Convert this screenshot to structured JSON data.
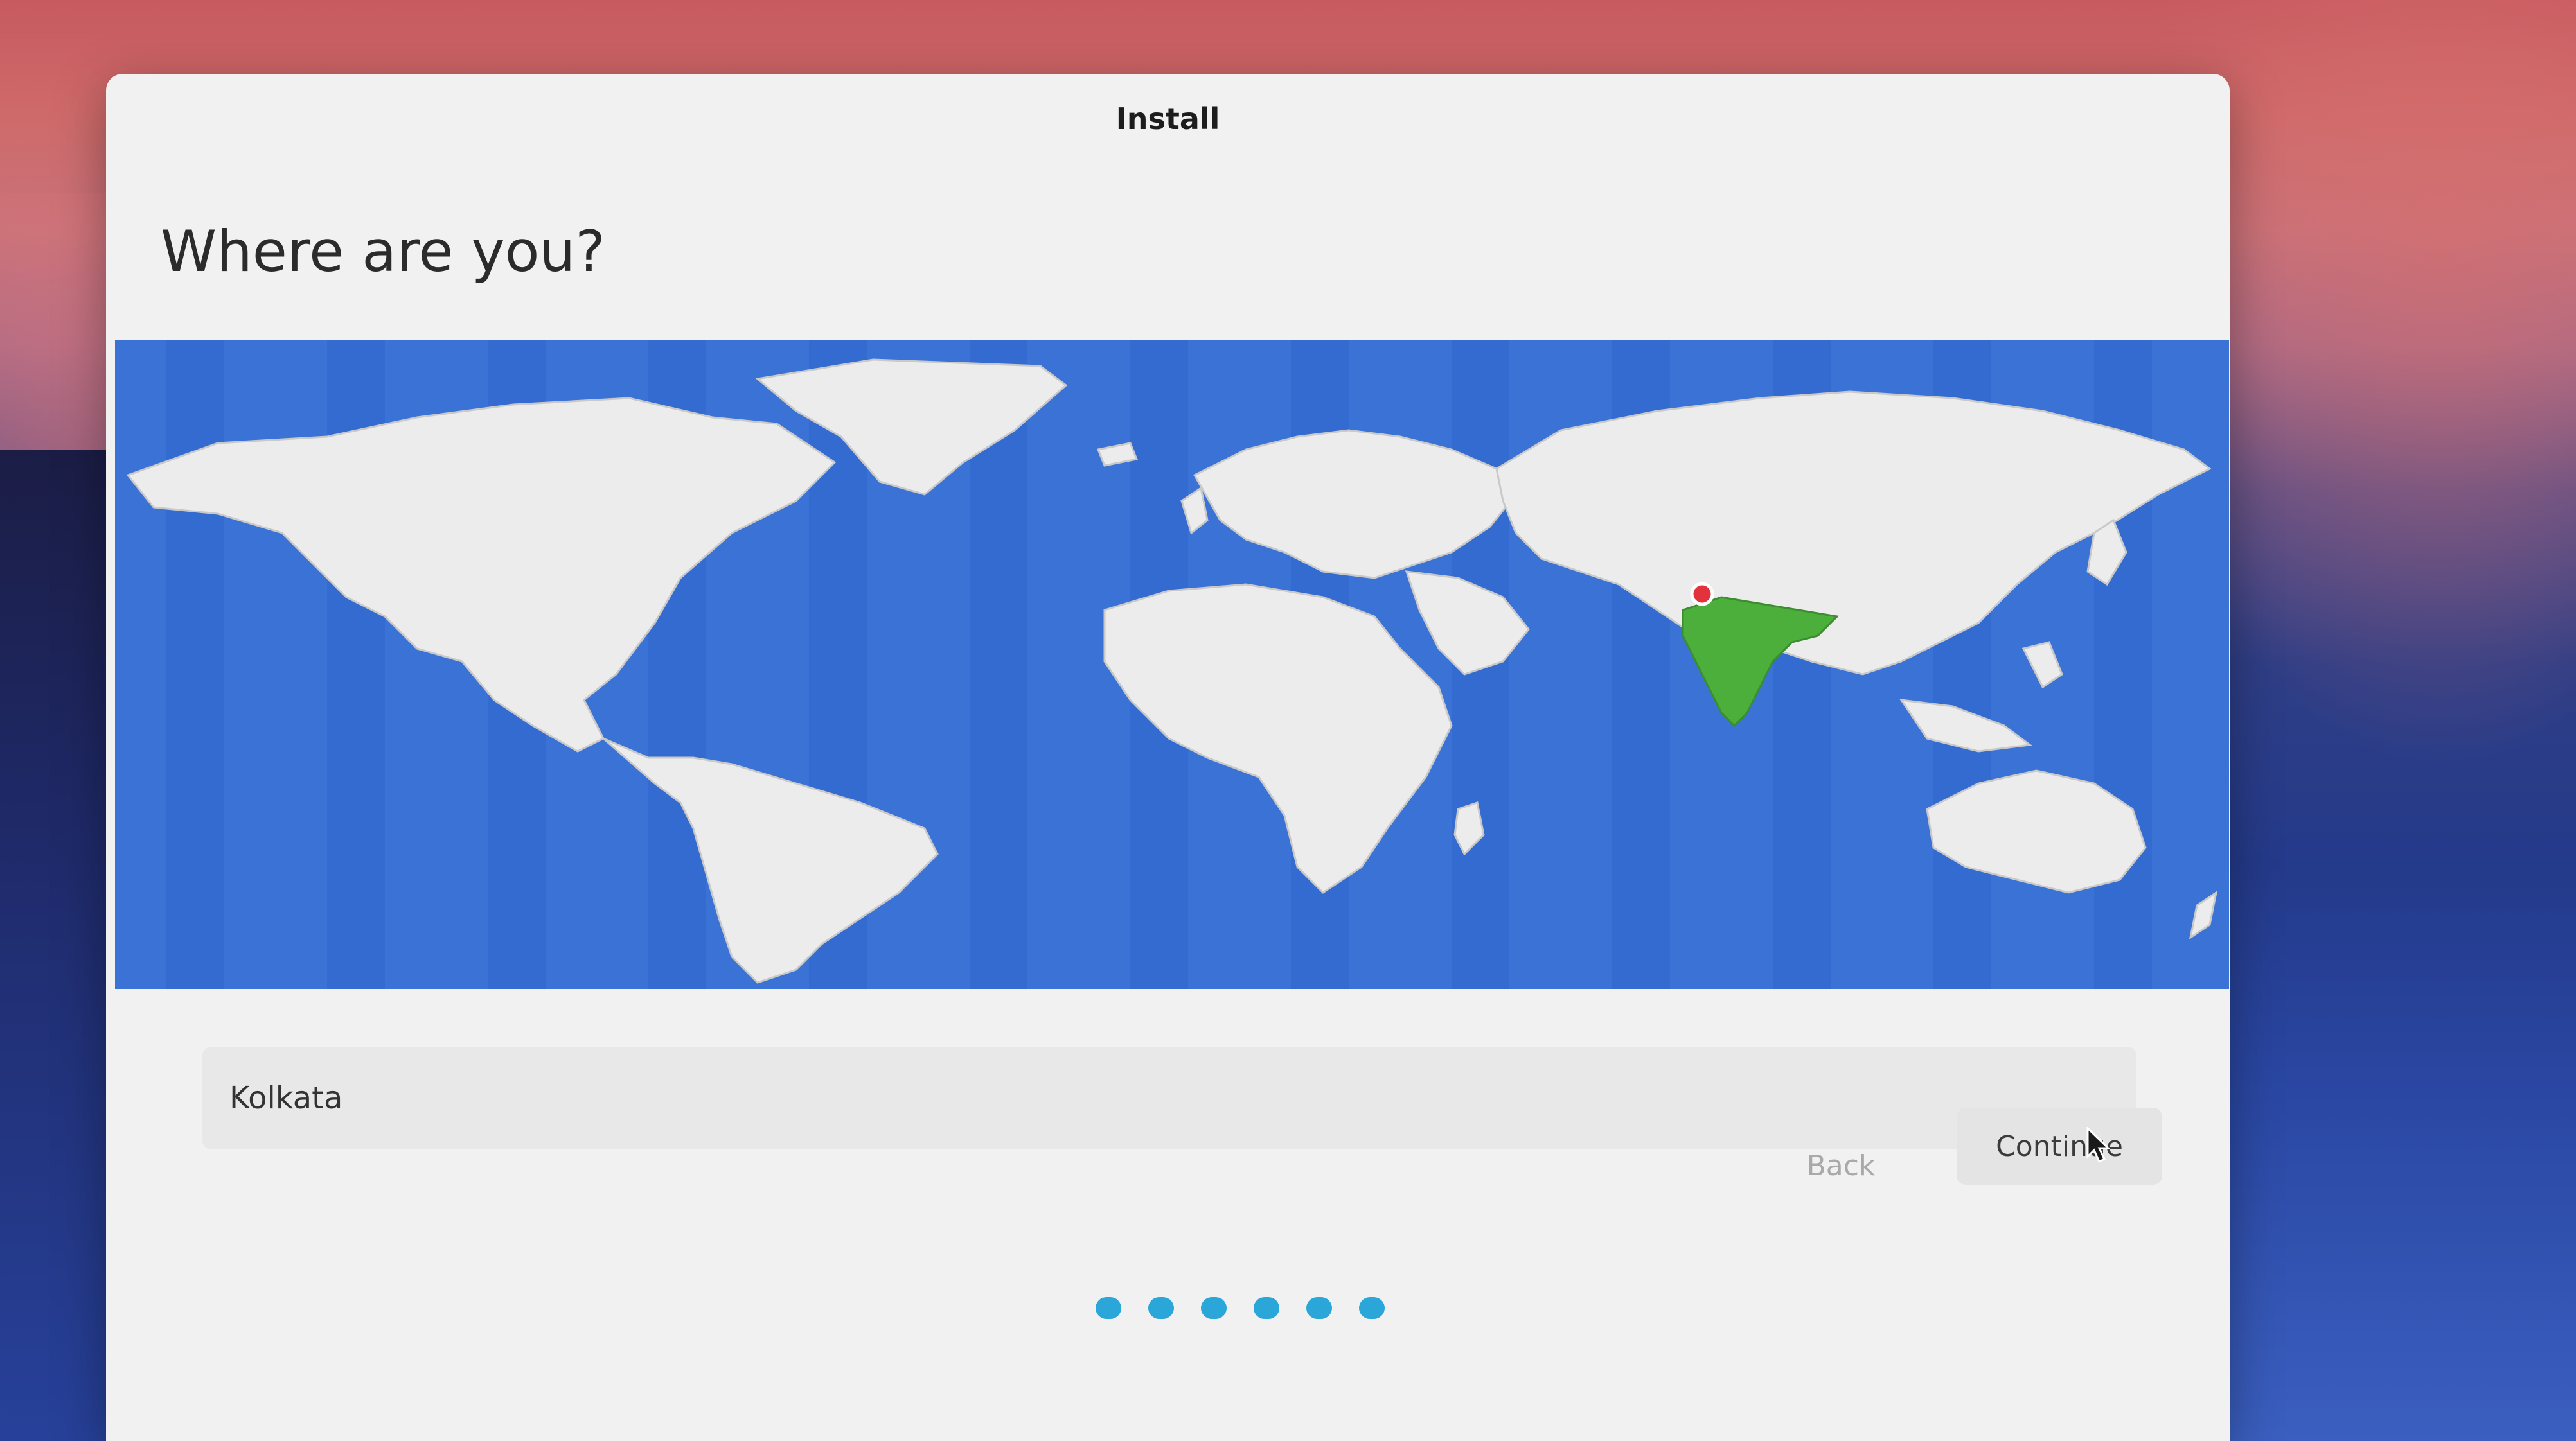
{
  "window": {
    "title": "Install"
  },
  "page": {
    "heading": "Where are you?"
  },
  "map": {
    "ocean_color": "#3a72d6",
    "land_color": "#ececec",
    "selected_region_color": "#4caf3c",
    "pin_color": "#e2323c",
    "icon": "world-map"
  },
  "timezone": {
    "value": "Kolkata"
  },
  "actions": {
    "back_label": "Back",
    "continue_label": "Continue"
  },
  "progress": {
    "total_steps": 6
  },
  "colors": {
    "accent": "#2aa7d8",
    "window_bg": "#f1f1f1"
  }
}
